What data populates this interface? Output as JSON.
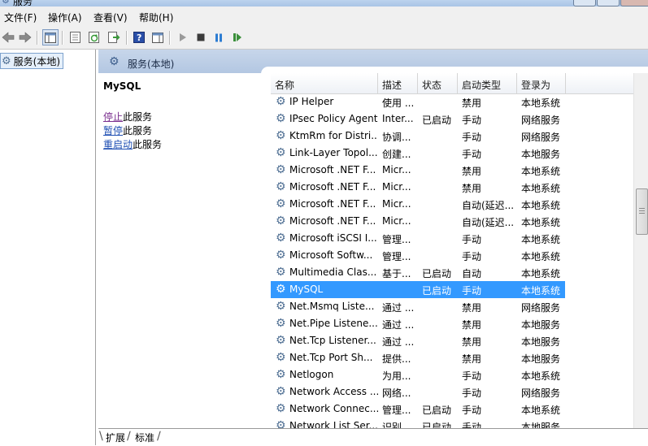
{
  "window": {
    "title": "服务"
  },
  "menu": [
    "文件(F)",
    "操作(A)",
    "查看(V)",
    "帮助(H)"
  ],
  "toolbar": {
    "back_icon": "arrow-left-icon",
    "forward_icon": "arrow-right-icon",
    "play_color": "#3a8f3a",
    "pause_color": "#2d7dd2"
  },
  "nav": {
    "root_label": "服务(本地)"
  },
  "pane": {
    "header_title": "服务(本地)"
  },
  "detail": {
    "title": "MySQL",
    "stop_link": "停止",
    "stop_suffix": "此服务",
    "pause_link": "暂停",
    "pause_suffix": "此服务",
    "restart_link": "重启动",
    "restart_suffix": "此服务"
  },
  "columns": [
    "名称",
    "描述",
    "状态",
    "启动类型",
    "登录为"
  ],
  "rows": [
    {
      "name": "IP Helper",
      "desc": "使用 ...",
      "status": "",
      "startup": "禁用",
      "logon": "本地系统"
    },
    {
      "name": "IPsec Policy Agent",
      "desc": "Inter...",
      "status": "已启动",
      "startup": "手动",
      "logon": "网络服务"
    },
    {
      "name": "KtmRm for Distri...",
      "desc": "协调...",
      "status": "",
      "startup": "手动",
      "logon": "网络服务"
    },
    {
      "name": "Link-Layer Topol...",
      "desc": "创建...",
      "status": "",
      "startup": "手动",
      "logon": "本地服务"
    },
    {
      "name": "Microsoft .NET F...",
      "desc": "Micr...",
      "status": "",
      "startup": "禁用",
      "logon": "本地系统"
    },
    {
      "name": "Microsoft .NET F...",
      "desc": "Micr...",
      "status": "",
      "startup": "禁用",
      "logon": "本地系统"
    },
    {
      "name": "Microsoft .NET F...",
      "desc": "Micr...",
      "status": "",
      "startup": "自动(延迟...",
      "logon": "本地系统"
    },
    {
      "name": "Microsoft .NET F...",
      "desc": "Micr...",
      "status": "",
      "startup": "自动(延迟...",
      "logon": "本地系统"
    },
    {
      "name": "Microsoft iSCSI I...",
      "desc": "管理...",
      "status": "",
      "startup": "手动",
      "logon": "本地系统"
    },
    {
      "name": "Microsoft Softw...",
      "desc": "管理...",
      "status": "",
      "startup": "手动",
      "logon": "本地系统"
    },
    {
      "name": "Multimedia Clas...",
      "desc": "基于...",
      "status": "已启动",
      "startup": "自动",
      "logon": "本地系统"
    },
    {
      "name": "MySQL",
      "desc": "",
      "status": "已启动",
      "startup": "手动",
      "logon": "本地系统"
    },
    {
      "name": "Net.Msmq Liste...",
      "desc": "通过 ...",
      "status": "",
      "startup": "禁用",
      "logon": "网络服务"
    },
    {
      "name": "Net.Pipe Listene...",
      "desc": "通过 ...",
      "status": "",
      "startup": "禁用",
      "logon": "本地服务"
    },
    {
      "name": "Net.Tcp Listener...",
      "desc": "通过 ...",
      "status": "",
      "startup": "禁用",
      "logon": "本地服务"
    },
    {
      "name": "Net.Tcp Port Sh...",
      "desc": "提供...",
      "status": "",
      "startup": "禁用",
      "logon": "本地服务"
    },
    {
      "name": "Netlogon",
      "desc": "为用...",
      "status": "",
      "startup": "手动",
      "logon": "本地系统"
    },
    {
      "name": "Network Access ...",
      "desc": "网络...",
      "status": "",
      "startup": "手动",
      "logon": "网络服务"
    },
    {
      "name": "Network Connec...",
      "desc": "管理...",
      "status": "已启动",
      "startup": "手动",
      "logon": "本地系统"
    },
    {
      "name": "Network List Ser...",
      "desc": "识别...",
      "status": "已启动",
      "startup": "手动",
      "logon": "本地服务"
    }
  ],
  "selected_index": 11,
  "tabs": [
    "扩展",
    "标准"
  ],
  "colors": {
    "selection": "#3399ff",
    "header_gradient_top": "#c7d6ea",
    "link": "#1f4fb3",
    "visited_link": "#7a2e8e"
  }
}
